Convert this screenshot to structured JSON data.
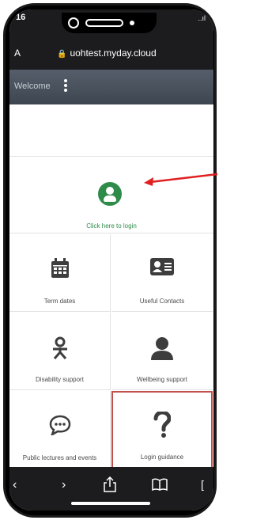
{
  "status": {
    "time": "16",
    "right": "..ıl"
  },
  "browser": {
    "aa_label": "A",
    "url": "uohtest.myday.cloud"
  },
  "header": {
    "welcome": "Welcome"
  },
  "login": {
    "label": "Click here to login"
  },
  "tiles": [
    {
      "label": "Term dates",
      "icon": "calendar-icon"
    },
    {
      "label": "Useful Contacts",
      "icon": "contact-card-icon"
    },
    {
      "label": "Disability support",
      "icon": "accessibility-icon"
    },
    {
      "label": "Wellbeing support",
      "icon": "person-icon"
    },
    {
      "label": "Public lectures and events",
      "icon": "chat-bubble-icon"
    },
    {
      "label": "Login guidance",
      "icon": "question-mark-icon"
    }
  ],
  "nav": {
    "back": "‹",
    "forward": "›",
    "share": "⇪",
    "bookmarks": "📖"
  },
  "colors": {
    "accent": "#2e8b4a",
    "header": "#4a535e",
    "highlight": "#c0504d",
    "arrow": "#e02020"
  }
}
